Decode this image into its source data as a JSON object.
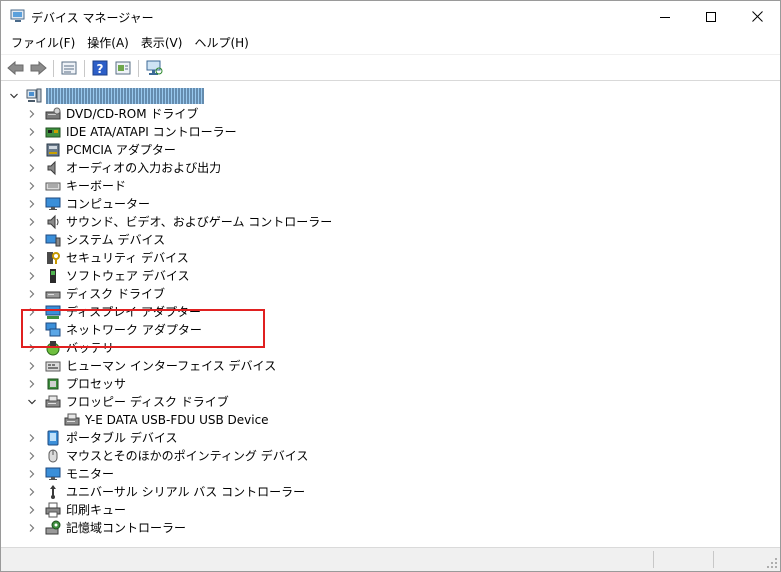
{
  "window": {
    "title": "デバイス マネージャー"
  },
  "menu": [
    "ファイル(F)",
    "操作(A)",
    "表示(V)",
    "ヘルプ(H)"
  ],
  "toolbar": {
    "buttons": [
      "back-icon",
      "forward-icon",
      "properties-icon",
      "help-icon",
      "update-driver-icon",
      "scan-hardware-icon"
    ]
  },
  "tree": {
    "root": {
      "label": "DESKTOP-XXXXXXXXXXXX",
      "expanded": true,
      "obscured": true
    },
    "categories": [
      {
        "label": "DVD/CD-ROM ドライブ",
        "icon": "dvd-drive-icon"
      },
      {
        "label": "IDE ATA/ATAPI コントローラー",
        "icon": "ide-controller-icon"
      },
      {
        "label": "PCMCIA アダプター",
        "icon": "pcmcia-icon"
      },
      {
        "label": "オーディオの入力および出力",
        "icon": "speaker-icon"
      },
      {
        "label": "キーボード",
        "icon": "keyboard-icon"
      },
      {
        "label": "コンピューター",
        "icon": "computer-icon"
      },
      {
        "label": "サウンド、ビデオ、およびゲーム コントローラー",
        "icon": "sound-icon"
      },
      {
        "label": "システム デバイス",
        "icon": "system-device-icon"
      },
      {
        "label": "セキュリティ デバイス",
        "icon": "security-device-icon"
      },
      {
        "label": "ソフトウェア デバイス",
        "icon": "software-device-icon"
      },
      {
        "label": "ディスク ドライブ",
        "icon": "disk-drive-icon"
      },
      {
        "label": "ディスプレイ アダプター",
        "icon": "display-adapter-icon"
      },
      {
        "label": "ネットワーク アダプター",
        "icon": "network-adapter-icon"
      },
      {
        "label": "バッテリ",
        "icon": "battery-icon"
      },
      {
        "label": "ヒューマン インターフェイス デバイス",
        "icon": "hid-icon"
      },
      {
        "label": "プロセッサ",
        "icon": "processor-icon"
      },
      {
        "label": "フロッピー ディスク ドライブ",
        "icon": "floppy-drive-icon",
        "expanded": true,
        "children": [
          {
            "label": "Y-E DATA USB-FDU USB Device",
            "icon": "floppy-device-icon"
          }
        ]
      },
      {
        "label": "ポータブル デバイス",
        "icon": "portable-device-icon"
      },
      {
        "label": "マウスとそのほかのポインティング デバイス",
        "icon": "mouse-icon"
      },
      {
        "label": "モニター",
        "icon": "monitor-icon"
      },
      {
        "label": "ユニバーサル シリアル バス コントローラー",
        "icon": "usb-icon"
      },
      {
        "label": "印刷キュー",
        "icon": "printer-icon"
      },
      {
        "label": "記憶域コントローラー",
        "icon": "storage-controller-icon"
      }
    ]
  },
  "colors": {
    "highlight_border": "#e02020",
    "selection": "#99c9ef"
  }
}
